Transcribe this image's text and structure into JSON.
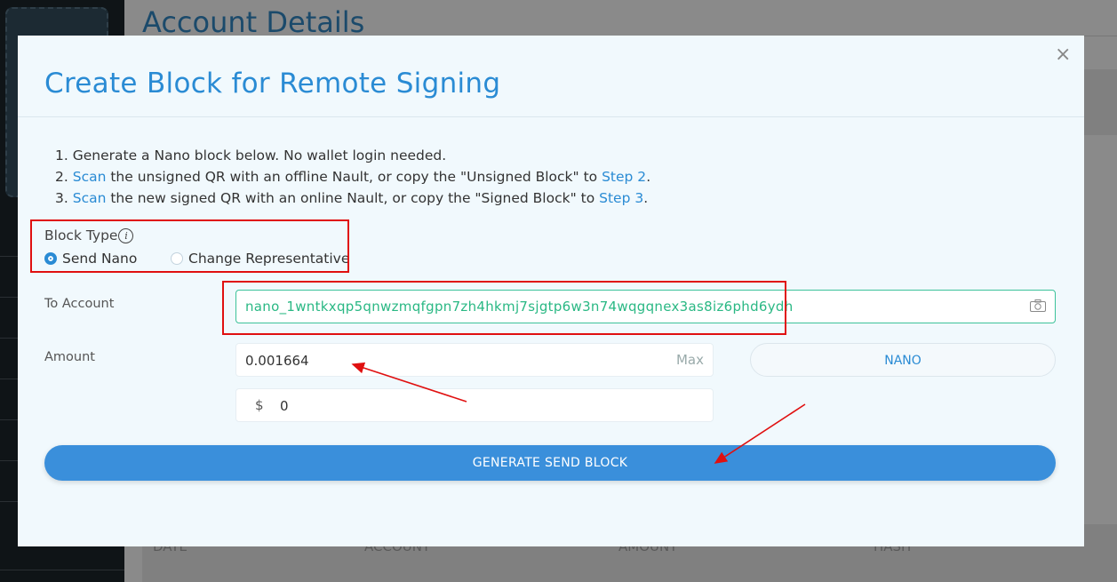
{
  "background": {
    "page_title": "Account Details",
    "table_headers": [
      "DATE",
      "ACCOUNT",
      "AMOUNT",
      "HASH"
    ]
  },
  "modal": {
    "title": "Create Block for Remote Signing",
    "close_icon": "×",
    "steps": [
      {
        "num": "1.",
        "pre": "Generate a Nano block below. No wallet login needed.",
        "link1": "",
        "mid": "",
        "link2": "",
        "post": ""
      },
      {
        "num": "2.",
        "pre": "",
        "link1": "Scan",
        "mid": " the unsigned QR with an offline Nault, or copy the \"Unsigned Block\" to ",
        "link2": "Step 2",
        "post": "."
      },
      {
        "num": "3.",
        "pre": "",
        "link1": "Scan",
        "mid": " the new signed QR with an online Nault, or copy the \"Signed Block\" to ",
        "link2": "Step 3",
        "post": "."
      }
    ],
    "block_type": {
      "label": "Block Type",
      "info_icon": "i",
      "options": [
        "Send Nano",
        "Change Representative"
      ],
      "selected": "Send Nano"
    },
    "to_account": {
      "label": "To Account",
      "value": "nano_1wntkxqp5qnwzmqfgpn7zh4hkmj7sjgtp6w3n74wqgqnex3as8iz6phd6ydh",
      "icon": "camera-icon"
    },
    "amount": {
      "label": "Amount",
      "value": "0.001664",
      "max_label": "Max",
      "unit": "NANO",
      "fiat_symbol": "$",
      "fiat_value": "0"
    },
    "generate_button": "GENERATE SEND BLOCK"
  },
  "colors": {
    "accent": "#2a8bd4",
    "account_text": "#2ab884",
    "annotation": "#e01010"
  }
}
